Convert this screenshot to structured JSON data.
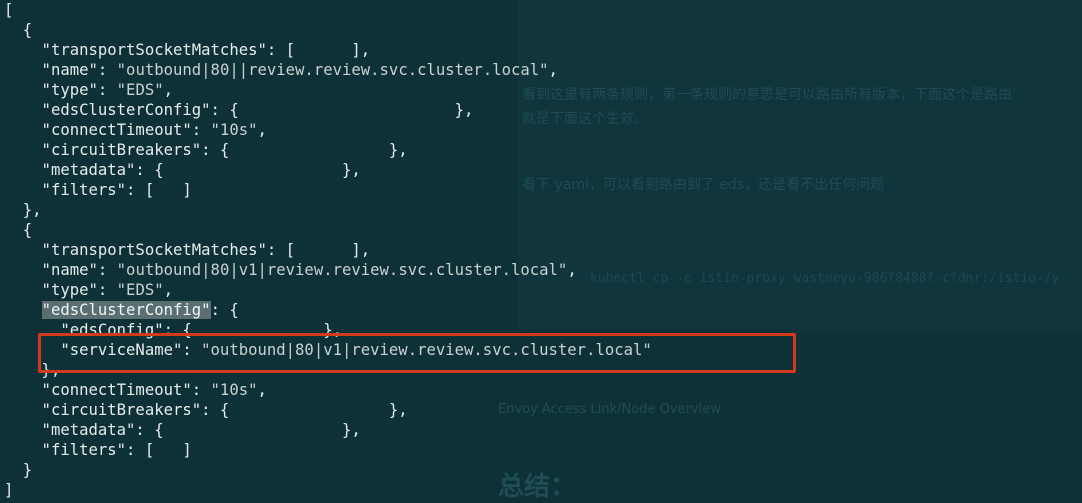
{
  "background_ghost": {
    "para1_line1": "看到这里有两条规则，第一条规则的意思是可以路由所有版本，下面这个是路由",
    "para1_line2": "就是下面这个生效。",
    "para2": "看下 yaml，可以看到路由到了 eds，还是看不出任何问题",
    "command": "kubectl cp -c istio-proxy wastmeyu-986f8488f-cfdnr:/istio-/y",
    "caption": "Envoy Access Link/Node Overview",
    "heading": "总结："
  },
  "code_lines": [
    [
      {
        "t": "["
      }
    ],
    [
      {
        "t": "  {"
      }
    ],
    [
      {
        "t": "    \"transportSocketMatches\": [      ],"
      }
    ],
    [
      {
        "t": "    \"name\": "
      },
      {
        "t": "\"outbound|80||review.review.svc.cluster.local\"",
        "c": "str"
      },
      {
        "t": ","
      }
    ],
    [
      {
        "t": "    \"type\": "
      },
      {
        "t": "\"EDS\"",
        "c": "str"
      },
      {
        "t": ","
      }
    ],
    [
      {
        "t": "    \"edsClusterConfig\": {                       },"
      }
    ],
    [
      {
        "t": "    \"connectTimeout\": "
      },
      {
        "t": "\"10s\"",
        "c": "str"
      },
      {
        "t": ","
      }
    ],
    [
      {
        "t": "    \"circuitBreakers\": {                 },"
      }
    ],
    [
      {
        "t": "    \"metadata\": {                   },"
      }
    ],
    [
      {
        "t": "    \"filters\": [   ]"
      }
    ],
    [
      {
        "t": "  },"
      }
    ],
    [
      {
        "t": "  {"
      }
    ],
    [
      {
        "t": "    \"transportSocketMatches\": [      ],"
      }
    ],
    [
      {
        "t": "    \"name\": "
      },
      {
        "t": "\"outbound|80|v1|review.review.svc.cluster.local\"",
        "c": "str"
      },
      {
        "t": ","
      }
    ],
    [
      {
        "t": "    \"type\": "
      },
      {
        "t": "\"EDS\"",
        "c": "str"
      },
      {
        "t": ","
      }
    ],
    [
      {
        "t": "    "
      },
      {
        "t": "\"edsClusterConfig\"",
        "c": "sel"
      },
      {
        "t": ": {"
      }
    ],
    [
      {
        "t": "      \"edsConfig\": {              },"
      }
    ],
    [
      {
        "t": "      \"serviceName\": "
      },
      {
        "t": "\"outbound|80|v1|review.review.svc.cluster.local\"",
        "c": "str"
      }
    ],
    [
      {
        "t": "    },"
      }
    ],
    [
      {
        "t": "    \"connectTimeout\": "
      },
      {
        "t": "\"10s\"",
        "c": "str"
      },
      {
        "t": ","
      }
    ],
    [
      {
        "t": "    \"circuitBreakers\": {                 },"
      }
    ],
    [
      {
        "t": "    \"metadata\": {                   },"
      }
    ],
    [
      {
        "t": "    \"filters\": [   ]"
      }
    ],
    [
      {
        "t": "  }"
      }
    ],
    [
      {
        "t": "]"
      }
    ]
  ],
  "colors": {
    "background": "#0e3138",
    "code_text": "#e6ecec",
    "selection": "#5b6f73",
    "highlight_box": "#d23a1c"
  }
}
